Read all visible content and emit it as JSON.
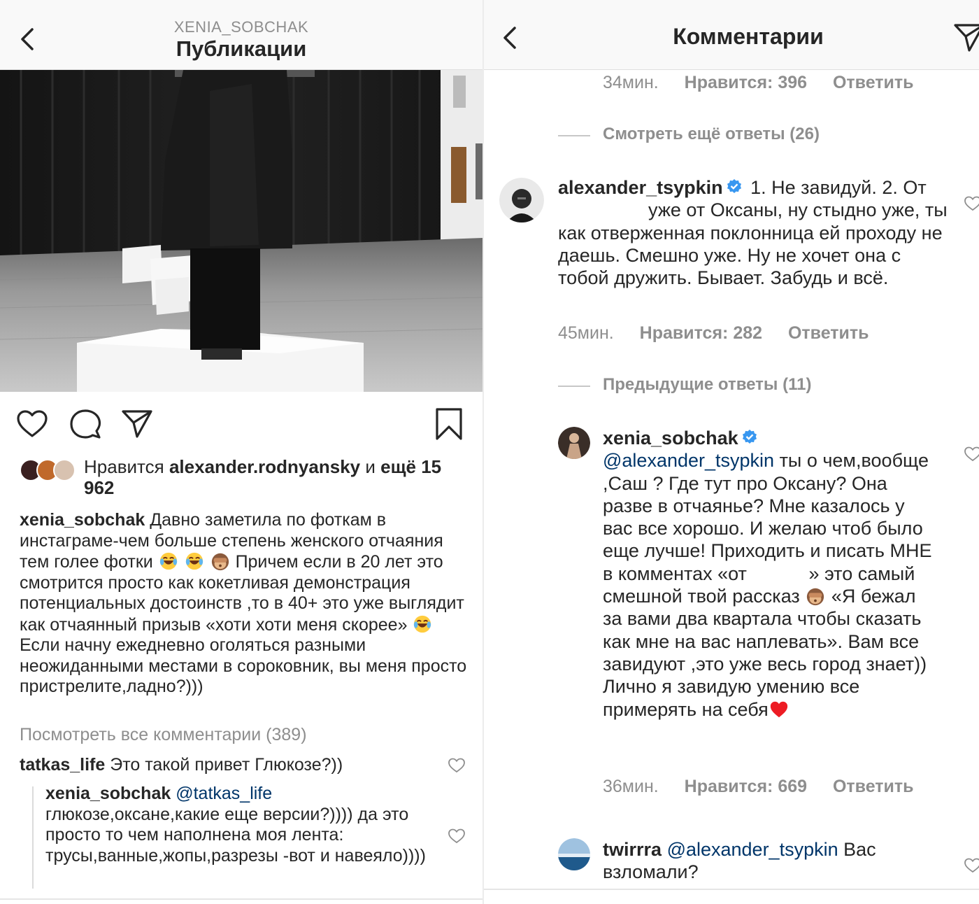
{
  "left": {
    "header": {
      "account": "XENIA_SOBCHAK",
      "title": "Публикации"
    },
    "photo": {
      "icon": "exhibition-photo"
    },
    "actions": {
      "like": "heart-icon",
      "comment": "comment-icon",
      "share": "paper-plane-icon",
      "save": "bookmark-icon"
    },
    "likes": {
      "prefix": "Нравится",
      "user": "alexander.rodnyansky",
      "and": "и",
      "more": "ещё 15 962"
    },
    "caption": {
      "user": "xenia_sobchak",
      "part1": "Давно заметила по фоткам в инстаграме-чем больше степень женского отчаяния тем голее фотки",
      "part2": "Причем если в 20 лет это смотрится просто как кокетливая демонстрация потенциальных достоинств ,то в 40+ это уже выглядит как отчаянный призыв «хоти хоти меня скорее»",
      "part3": "Если начну ежедневно оголяться разными неожиданными местами в сороковник, вы меня просто пристрелите,ладно?)))"
    },
    "view_all": "Посмотреть все комментарии (389)",
    "comments": [
      {
        "user": "tatkas_life",
        "text": "Это такой привет Глюкозе?))"
      },
      {
        "user": "xenia_sobchak",
        "mention": "@tatkas_life",
        "text": "глюкозе,оксане,какие еще версии?)))) да это просто то чем наполнена моя лента: трусы,ванные,жопы,разрезы -вот и навеяло))))"
      }
    ]
  },
  "right": {
    "header": {
      "title": "Комментарии"
    },
    "top_meta": {
      "time": "34мин.",
      "likes": "Нравится: 396",
      "reply": "Ответить"
    },
    "more_replies_1": "Смотреть ещё ответы (26)",
    "comment_a": {
      "user": "alexander_tsypkin",
      "text_1": "1. Не завидуй. 2. От",
      "text_2": "уже от Оксаны, ну стыдно уже, ты как отверженная поклонница ей проходу не даешь. Смешно уже. Ну не хочет она с тобой дружить. Бывает. Забудь и всё.",
      "time": "45мин.",
      "likes": "Нравится: 282",
      "reply": "Ответить"
    },
    "more_replies_2": "Предыдущие ответы (11)",
    "comment_b": {
      "user": "xenia_sobchak",
      "mention": "@alexander_tsypkin",
      "text_1": "ты о чем,вообще ,Саш ? Где тут про Оксану? Она разве в отчаянье? Мне казалось у вас все хорошо. И желаю чтоб было еще лучше! Приходить и писать МНЕ в комментах «от",
      "text_2": "» это самый смешной твой рассказ",
      "text_3": "«Я бежал за вами два квартала чтобы сказать как мне на вас наплевать». Вам все завидуют ,это уже весь город знает)) Лично я завидую умению все примерять на себя",
      "time": "36мин.",
      "likes": "Нравится: 669",
      "reply": "Ответить"
    },
    "comment_c": {
      "user": "twirrra",
      "mention": "@alexander_tsypkin",
      "text": "Вас взломали?"
    }
  },
  "colors": {
    "text": "#262626",
    "muted": "#8e8e8e",
    "mention": "#003569",
    "verified": "#3897f0",
    "heart": "#ed1c24"
  }
}
